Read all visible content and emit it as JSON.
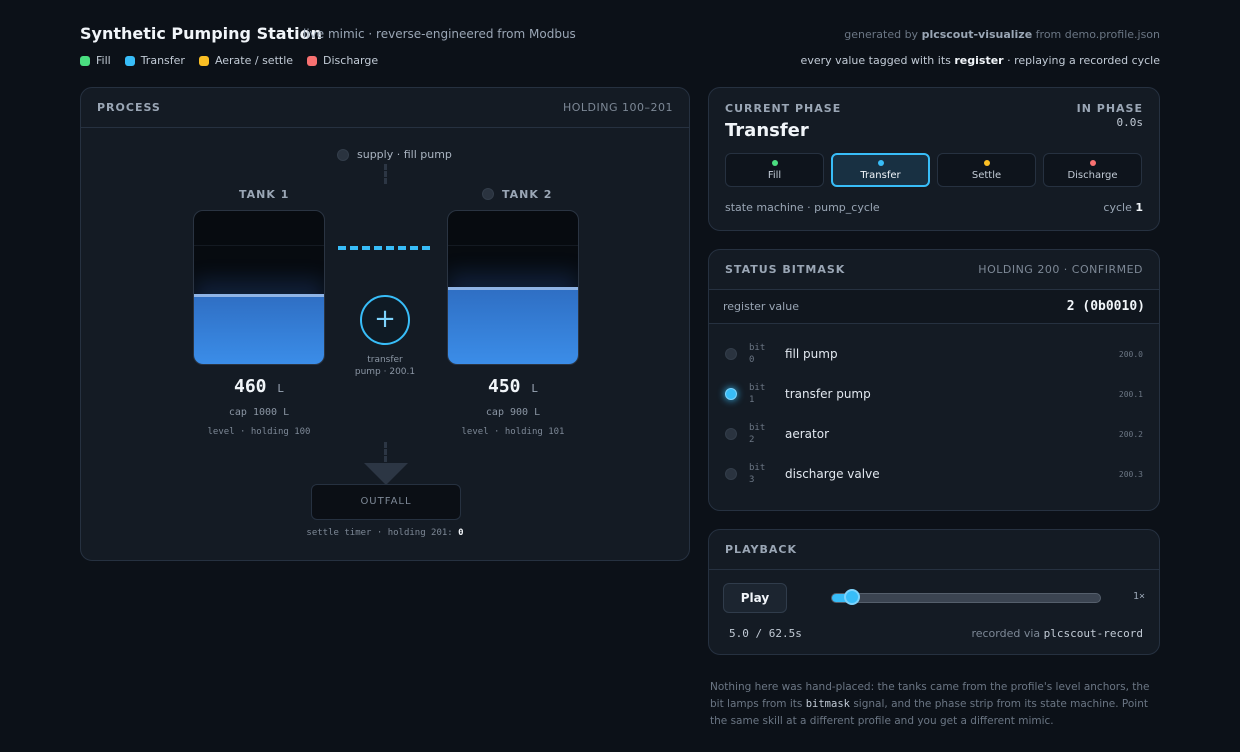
{
  "header": {
    "title": "Synthetic Pumping Station",
    "subtitle": "live mimic · reverse-engineered from Modbus",
    "generated_prefix": "generated by",
    "generated_tool": "plcscout-visualize",
    "generated_suffix": "from demo.profile.json",
    "note_prefix": "every value tagged with its",
    "note_strong": "register",
    "note_suffix": "· replaying a recorded cycle"
  },
  "legend": [
    {
      "label": "Fill",
      "color": "#4ade80"
    },
    {
      "label": "Transfer",
      "color": "#38bdf8"
    },
    {
      "label": "Aerate / settle",
      "color": "#fbbf24"
    },
    {
      "label": "Discharge",
      "color": "#f87171"
    }
  ],
  "process": {
    "title": "PROCESS",
    "range": "HOLDING 100–201",
    "supply_label": "supply · fill pump",
    "pump_label_1": "transfer",
    "pump_label_2": "pump · 200.1",
    "outfall": "OUTFALL",
    "settle_label": "settle timer · holding 201:",
    "settle_value": "0",
    "tanks": [
      {
        "name": "TANK 1",
        "value": "460",
        "unit": "L",
        "cap": "cap 1000 L",
        "reg": "level · holding 100",
        "fill_fraction": 0.46
      },
      {
        "name": "TANK 2",
        "value": "450",
        "unit": "L",
        "cap": "cap 900 L",
        "reg": "level · holding 101",
        "fill_fraction": 0.5
      }
    ]
  },
  "phase": {
    "label": "CURRENT PHASE",
    "name": "Transfer",
    "in_phase_label": "IN PHASE",
    "in_phase_value": "0.0s",
    "steps": [
      {
        "label": "Fill",
        "color": "#4ade80",
        "active": false
      },
      {
        "label": "Transfer",
        "color": "#38bdf8",
        "active": true
      },
      {
        "label": "Settle",
        "color": "#fbbf24",
        "active": false
      },
      {
        "label": "Discharge",
        "color": "#f87171",
        "active": false
      }
    ],
    "state_machine": "state machine · pump_cycle",
    "cycle_label": "cycle",
    "cycle_value": "1"
  },
  "status": {
    "title": "STATUS BITMASK",
    "right": "HOLDING 200 · CONFIRMED",
    "register_label": "register value",
    "register_value": "2 (0b0010)",
    "bits": [
      {
        "bit": "bit",
        "index": "0",
        "name": "fill pump",
        "reg": "200.0",
        "on": false
      },
      {
        "bit": "bit",
        "index": "1",
        "name": "transfer pump",
        "reg": "200.1",
        "on": true
      },
      {
        "bit": "bit",
        "index": "2",
        "name": "aerator",
        "reg": "200.2",
        "on": false
      },
      {
        "bit": "bit",
        "index": "3",
        "name": "discharge valve",
        "reg": "200.3",
        "on": false
      }
    ]
  },
  "playback": {
    "title": "PLAYBACK",
    "play_label": "Play",
    "speed": "1×",
    "time": "5.0 / 62.5s",
    "position_fraction": 0.08,
    "recorded_prefix": "recorded via",
    "recorded_tool": "plcscout-record"
  },
  "footnote": {
    "part1": "Nothing here was hand-placed: the tanks came from the profile's level anchors, the bit lamps from its",
    "code": "bitmask",
    "part2": "signal, and the phase strip from its state machine. Point the same skill at a different profile and you get a different mimic."
  }
}
